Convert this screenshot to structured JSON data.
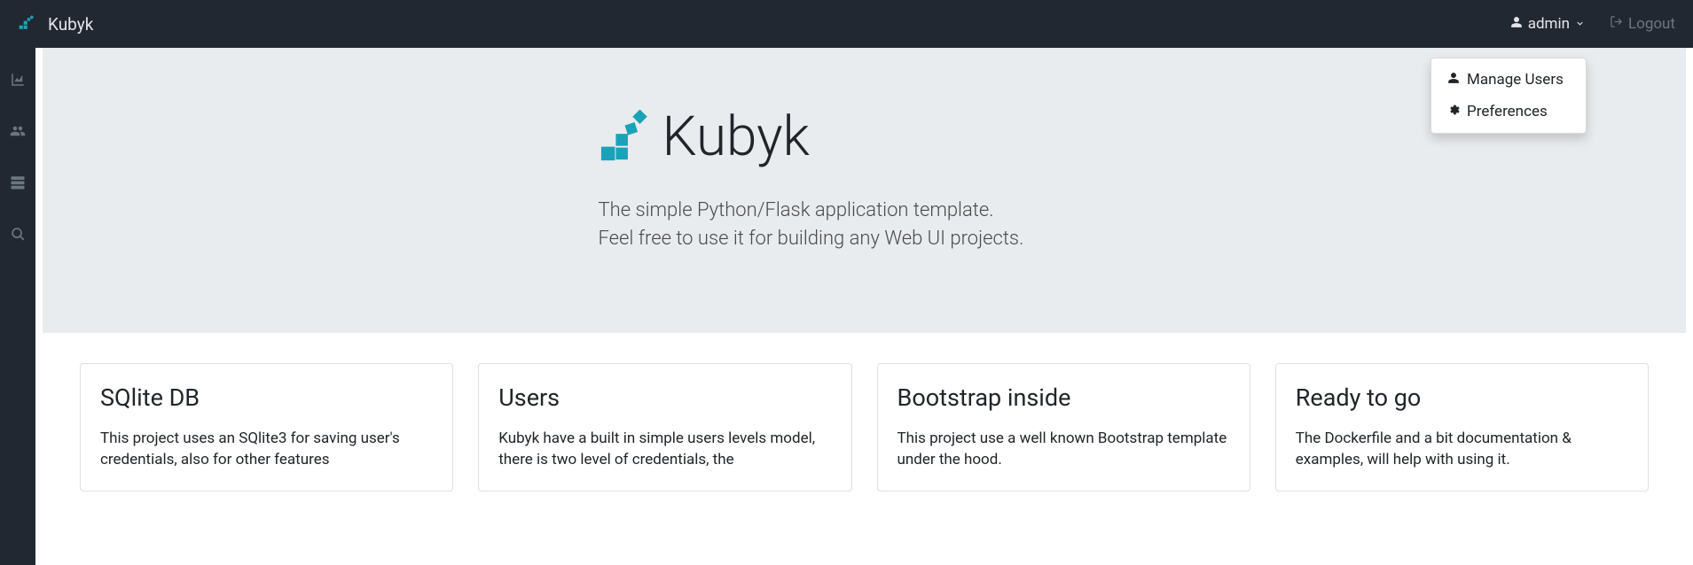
{
  "brand": "Kubyk",
  "user": {
    "name": "admin",
    "dropdown": [
      {
        "label": "Manage Users"
      },
      {
        "label": "Preferences"
      }
    ]
  },
  "logout_label": "Logout",
  "jumbotron": {
    "title": "Kubyk",
    "line1": "The simple Python/Flask application template.",
    "line2": "Feel free to use it for building any Web UI projects."
  },
  "cards": [
    {
      "title": "SQlite DB",
      "text": "This project uses an SQlite3 for saving user's credentials, also for other features"
    },
    {
      "title": "Users",
      "text": "Kubyk have a built in simple users levels model, there is two level of credentials, the"
    },
    {
      "title": "Bootstrap inside",
      "text": "This project use a well known Bootstrap template under the hood."
    },
    {
      "title": "Ready to go",
      "text": "The Dockerfile and a bit documentation & examples, will help with using it."
    }
  ]
}
